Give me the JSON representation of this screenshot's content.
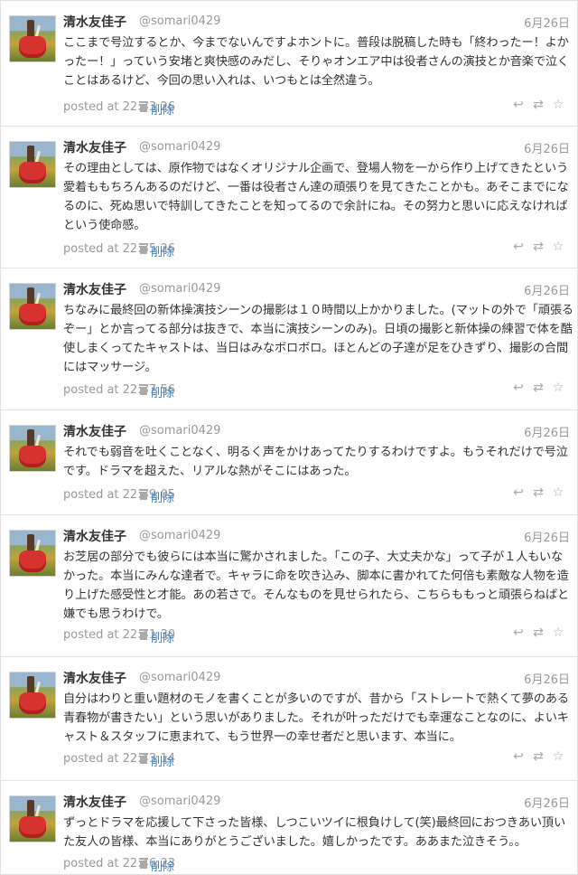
{
  "tweets": [
    {
      "name": "清水友佳子",
      "handle": "@somari0429",
      "date": "6月26日",
      "text": "ここまで号泣するとか、今までないんですよホントに。普段は脱稿した時も「終わったー！よかったー！」っていう安堵と爽快感のみだし、そりゃオンエア中は役者さんの演技とか音楽で泣くことはあるけど、今回の思い入れは、いつもとは全然違う。",
      "posted": "posted at 22:33:26",
      "delete_label": "削除"
    },
    {
      "name": "清水友佳子",
      "handle": "@somari0429",
      "date": "6月26日",
      "text": "その理由としては、原作物ではなくオリジナル企画で、登場人物を一から作り上げてきたという愛着ももちろんあるのだけど、一番は役者さん達の頑張りを見てきたことかも。あそこまでになるのに、死ぬ思いで特訓してきたことを知ってるので余計にね。その努力と思いに応えなければという使命感。",
      "posted": "posted at 22:35:26",
      "delete_label": "削除"
    },
    {
      "name": "清水友佳子",
      "handle": "@somari0429",
      "date": "6月26日",
      "text": "ちなみに最終回の新体操演技シーンの撮影は１０時間以上かかりました。(マットの外で「頑張るぞー」とか言ってる部分は抜きで、本当に演技シーンのみ)。日頃の撮影と新体操の練習で体を酷使しまくってたキャストは、当日はみなボロボロ。ほとんどの子達が足をひきずり、撮影の合間にはマッサージ。",
      "posted": "posted at 22:37:56",
      "delete_label": "削除"
    },
    {
      "name": "清水友佳子",
      "handle": "@somari0429",
      "date": "6月26日",
      "text": "それでも弱音を吐くことなく、明るく声をかけあってたりするわけですよ。もうそれだけで号泣です。ドラマを超えた、リアルな熱がそこにはあった。",
      "posted": "posted at 22:39:05",
      "delete_label": "削除"
    },
    {
      "name": "清水友佳子",
      "handle": "@somari0429",
      "date": "6月26日",
      "text": "お芝居の部分でも彼らには本当に驚かされました。「この子、大丈夫かな」って子が１人もいなかった。本当にみんな達者で。キャラに命を吹き込み、脚本に書かれてた何倍も素敵な人物を造り上げた感受性と才能。あの若さで。そんなものを見せられたら、こちらももっと頑張らねばと嫌でも思うわけで。",
      "posted": "posted at 22:41:30",
      "delete_label": "削除"
    },
    {
      "name": "清水友佳子",
      "handle": "@somari0429",
      "date": "6月26日",
      "text": "自分はわりと重い題材のモノを書くことが多いのですが、昔から「ストレートで熱くて夢のある青春物が書きたい」という思いがありました。それが叶っただけでも幸運なことなのに、よいキャスト＆スタッフに恵まれて、もう世界一の幸せ者だと思います、本当に。",
      "posted": "posted at 22:43:14",
      "delete_label": "削除"
    },
    {
      "name": "清水友佳子",
      "handle": "@somari0429",
      "date": "6月26日",
      "text": "ずっとドラマを応援して下さった皆様、しつこいツイに根負けして(笑)最終回におつきあい頂いた友人の皆様、本当にありがとうございました。嬉しかったです。ああまた泣きそう。。",
      "posted": "posted at 22:46:23",
      "delete_label": "削除"
    }
  ],
  "icons": {
    "reply": "reply-icon",
    "retweet": "retweet-icon",
    "favorite": "star-icon"
  },
  "colors": {
    "link": "#3f80b8",
    "meta": "#999999",
    "text": "#333333"
  }
}
